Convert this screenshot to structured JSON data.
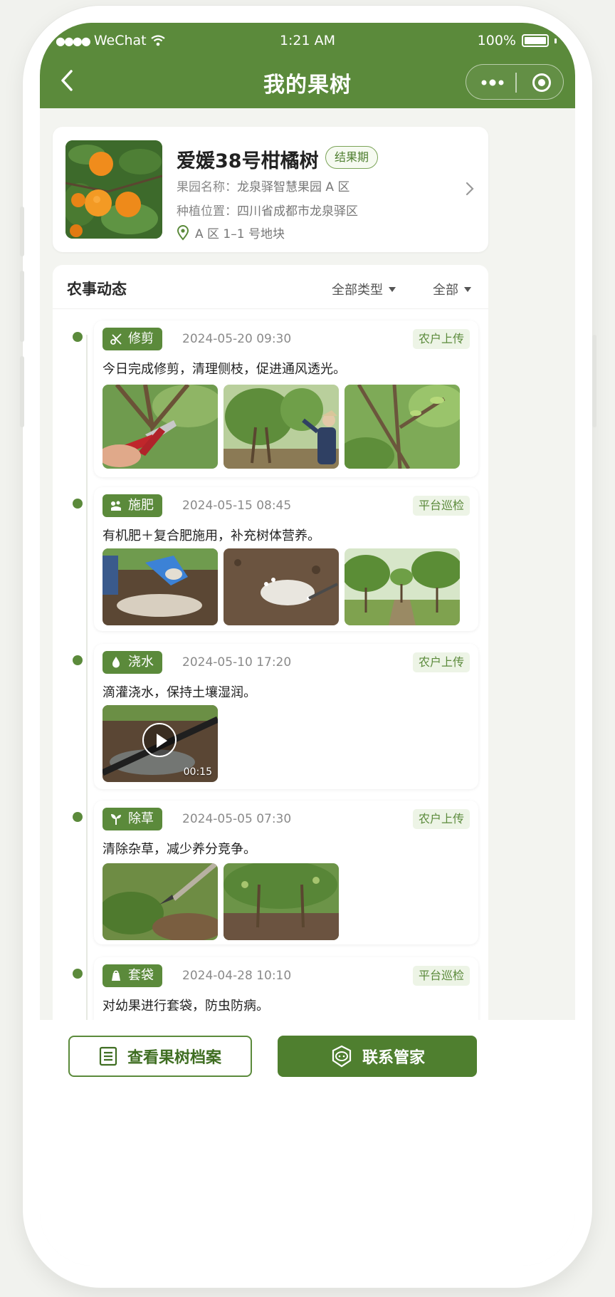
{
  "status_bar": {
    "carrier": "WeChat",
    "time": "1:21 AM",
    "battery": "100%"
  },
  "nav": {
    "title": "我的果树"
  },
  "tree": {
    "name": "爱媛38号柑橘树",
    "stage": "结果期",
    "orchard_label": "果园名称：",
    "orchard": "龙泉驿智慧果园 A 区",
    "location_label": "种植位置：",
    "location": "四川省成都市龙泉驿区",
    "plot": "A 区 1–1 号地块"
  },
  "feed": {
    "title": "农事动态",
    "filter_type": "全部类型",
    "filter_source": "全部",
    "entries": [
      {
        "type": "修剪",
        "icon": "scissors-icon",
        "time": "2024-05-20  09:30",
        "source": "农户上传",
        "desc": "今日完成修剪，清理侧枝，促进通风透光。"
      },
      {
        "type": "施肥",
        "icon": "fertilizer-icon",
        "time": "2024-05-15  08:45",
        "source": "平台巡检",
        "desc": "有机肥＋复合肥施用，补充树体营养。"
      },
      {
        "type": "浇水",
        "icon": "water-drop-icon",
        "time": "2024-05-10  17:20",
        "source": "农户上传",
        "desc": "滴灌浇水，保持土壤湿润。",
        "video_duration": "00:15"
      },
      {
        "type": "除草",
        "icon": "sprout-icon",
        "time": "2024-05-05  07:30",
        "source": "农户上传",
        "desc": "清除杂草，减少养分竞争。"
      },
      {
        "type": "套袋",
        "icon": "bag-icon",
        "time": "2024-04-28  10:10",
        "source": "平台巡检",
        "desc": "对幼果进行套袋，防虫防病。"
      }
    ]
  },
  "actions": {
    "archive": "查看果树档案",
    "contact": "联系管家"
  },
  "colors": {
    "primary": "#5b8a3b",
    "tag_bg": "#edf4e6",
    "page_bg": "#f3f4f0"
  }
}
